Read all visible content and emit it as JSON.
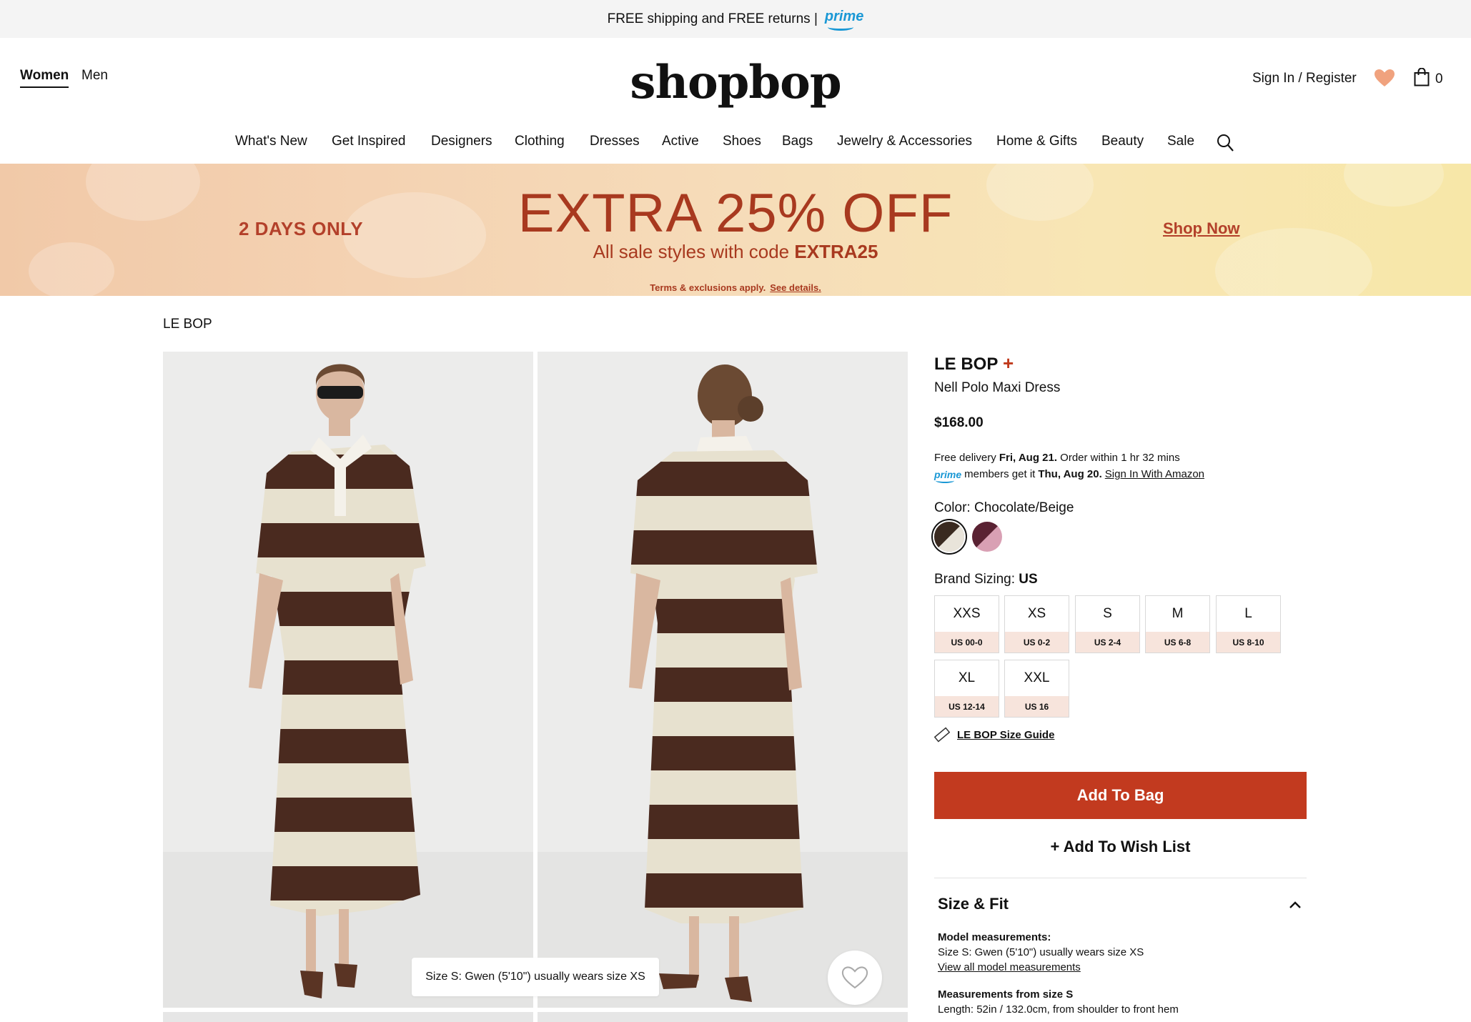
{
  "topbar": {
    "text": "FREE shipping and FREE returns |",
    "prime": "prime"
  },
  "header": {
    "gender_tabs": [
      "Women",
      "Men"
    ],
    "logo": "shopbop",
    "signin": "Sign In / Register",
    "bag_count": "0"
  },
  "nav": {
    "items": [
      "What's New",
      "Get Inspired",
      "Designers",
      "Clothing",
      "Dresses",
      "Active",
      "Shoes",
      "Bags",
      "Jewelry & Accessories",
      "Home & Gifts",
      "Beauty",
      "Sale"
    ]
  },
  "banner": {
    "left": "2 DAYS ONLY",
    "headline": "EXTRA 25% OFF",
    "sub_pre": "All sale styles with code ",
    "sub_code": "EXTRA25",
    "terms": "Terms & exclusions apply.",
    "terms_link": "See details.",
    "cta": "Shop Now"
  },
  "breadcrumb": "LE BOP",
  "gallery": {
    "model_tip": "Size S: Gwen (5'10\") usually wears size XS"
  },
  "product": {
    "brand": "LE BOP",
    "brand_plus": "+",
    "name": "Nell Polo Maxi Dress",
    "price": "$168.00",
    "delivery_pre": "Free delivery ",
    "delivery_date": "Fri, Aug 21.",
    "delivery_post": " Order within 1 hr 32 mins",
    "prime_label": "prime",
    "prime_pre": "members get it ",
    "prime_date": "Thu, Aug 20.",
    "prime_link": "Sign In With Amazon",
    "color_label": "Color: ",
    "color_value": "Chocolate/Beige",
    "swatches": [
      {
        "name": "Chocolate/Beige",
        "c1": "#3a2a20",
        "c2": "#e9e4da",
        "selected": true
      },
      {
        "name": "Plum/Pink",
        "c1": "#5a2233",
        "c2": "#d9a0b4",
        "selected": false
      }
    ],
    "sizing_label": "Brand Sizing: ",
    "sizing_value": "US",
    "sizes": [
      {
        "label": "XXS",
        "us": "US 00-0"
      },
      {
        "label": "XS",
        "us": "US 0-2"
      },
      {
        "label": "S",
        "us": "US 2-4"
      },
      {
        "label": "M",
        "us": "US 6-8"
      },
      {
        "label": "L",
        "us": "US 8-10"
      },
      {
        "label": "XL",
        "us": "US 12-14"
      },
      {
        "label": "XXL",
        "us": "US 16"
      }
    ],
    "size_guide": "LE BOP Size Guide",
    "add_to_bag": "Add To Bag",
    "add_to_wishlist": "+ Add To Wish List"
  },
  "size_fit": {
    "title": "Size & Fit",
    "model_heading": "Model measurements:",
    "model_text": "Size S: Gwen (5'10\") usually wears size XS",
    "model_link": "View all model measurements",
    "meas_heading": "Measurements from size S",
    "meas_text": "Length: 52in / 132.0cm, from shoulder to front hem"
  },
  "colors": {
    "accent": "#c23a1f",
    "banner_text": "#a8391f",
    "size_tag_bg": "#f7e4dc",
    "prime_blue": "#1a98d5"
  }
}
